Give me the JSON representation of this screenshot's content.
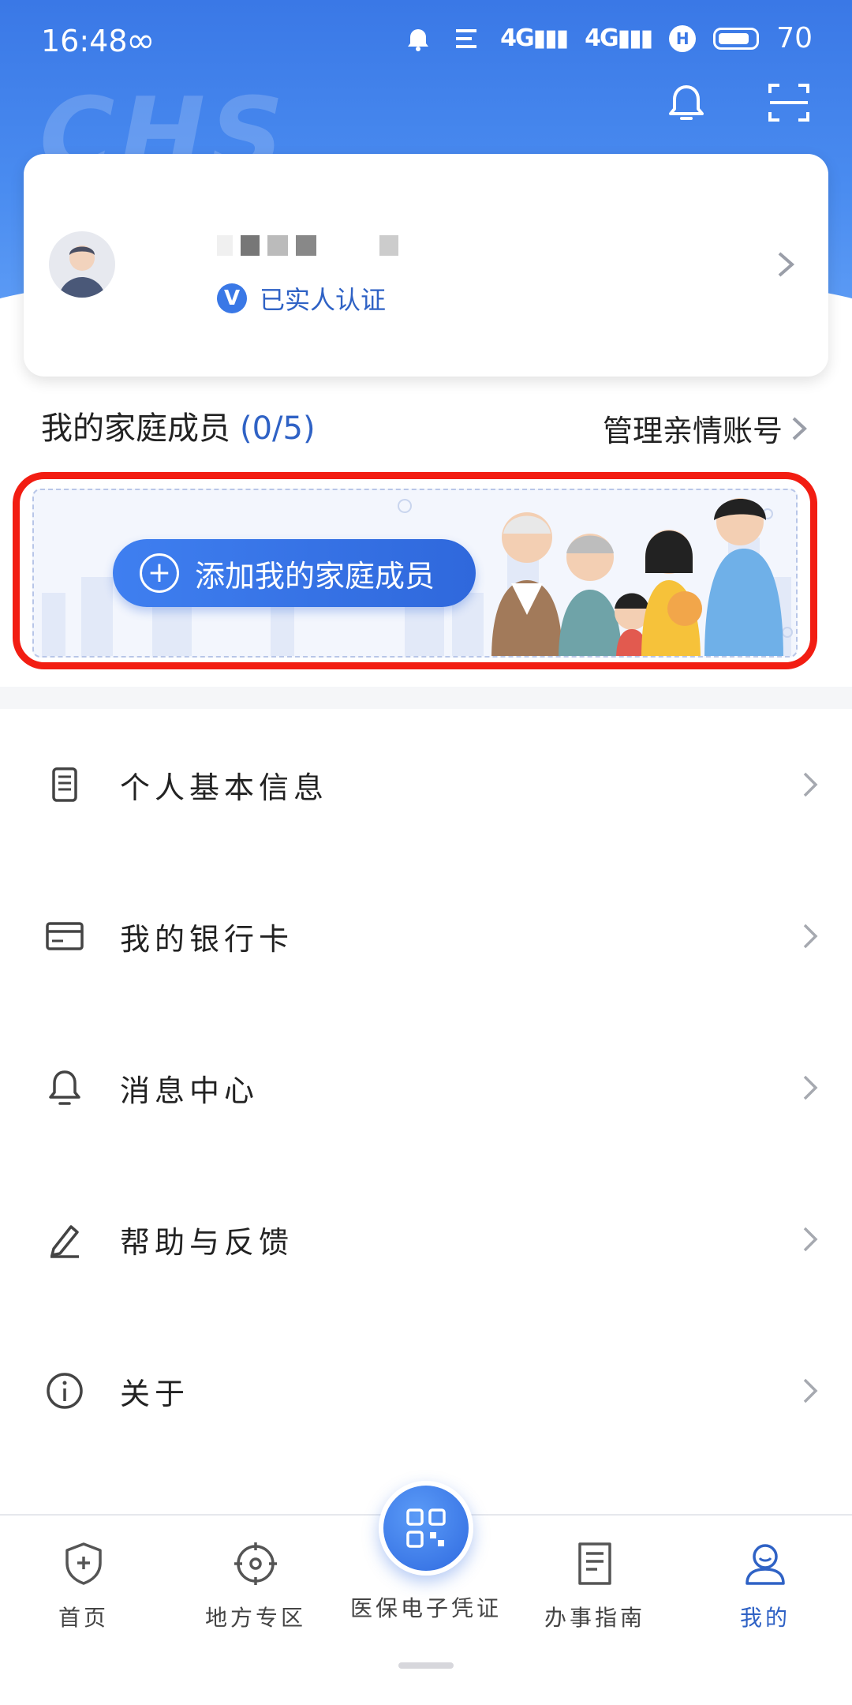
{
  "status_bar": {
    "time": "16:48",
    "battery": "70"
  },
  "header": {
    "watermark": "CHS"
  },
  "profile": {
    "verified_label": "已实人认证"
  },
  "family": {
    "title": "我的家庭成员",
    "count": "(0/5)",
    "manage_label": "管理亲情账号",
    "add_button_label": "添加我的家庭成员"
  },
  "menu": {
    "items": [
      {
        "label": "个人基本信息",
        "icon": "document-icon"
      },
      {
        "label": "我的银行卡",
        "icon": "bank-card-icon"
      },
      {
        "label": "消息中心",
        "icon": "bell-icon"
      },
      {
        "label": "帮助与反馈",
        "icon": "pen-icon"
      },
      {
        "label": "关于",
        "icon": "info-icon"
      }
    ]
  },
  "bottom_nav": {
    "items": [
      {
        "label": "首页",
        "icon": "shield-plus-icon"
      },
      {
        "label": "地方专区",
        "icon": "target-icon"
      },
      {
        "label": "医保电子凭证",
        "icon": "qr-code-icon"
      },
      {
        "label": "办事指南",
        "icon": "guide-document-icon"
      },
      {
        "label": "我的",
        "icon": "user-icon"
      }
    ],
    "active": "我的"
  },
  "colors": {
    "primary": "#3a78e6",
    "highlight_border": "#f21d12"
  }
}
